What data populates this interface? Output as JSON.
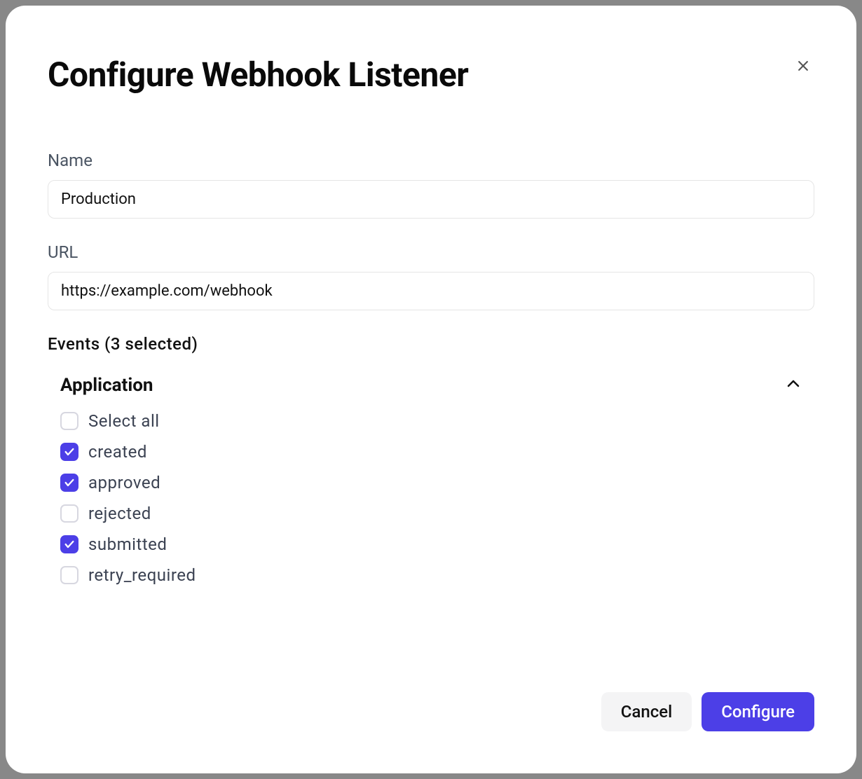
{
  "dialog": {
    "title": "Configure Webhook Listener"
  },
  "form": {
    "name_label": "Name",
    "name_value": "Production",
    "url_label": "URL",
    "url_value": "https://example.com/webhook",
    "events_heading": "Events (3 selected)"
  },
  "events_group": {
    "title": "Application",
    "items": [
      {
        "label": "Select all",
        "checked": false
      },
      {
        "label": "created",
        "checked": true
      },
      {
        "label": "approved",
        "checked": true
      },
      {
        "label": "rejected",
        "checked": false
      },
      {
        "label": "submitted",
        "checked": true
      },
      {
        "label": "retry_required",
        "checked": false
      }
    ]
  },
  "footer": {
    "cancel_label": "Cancel",
    "configure_label": "Configure"
  }
}
